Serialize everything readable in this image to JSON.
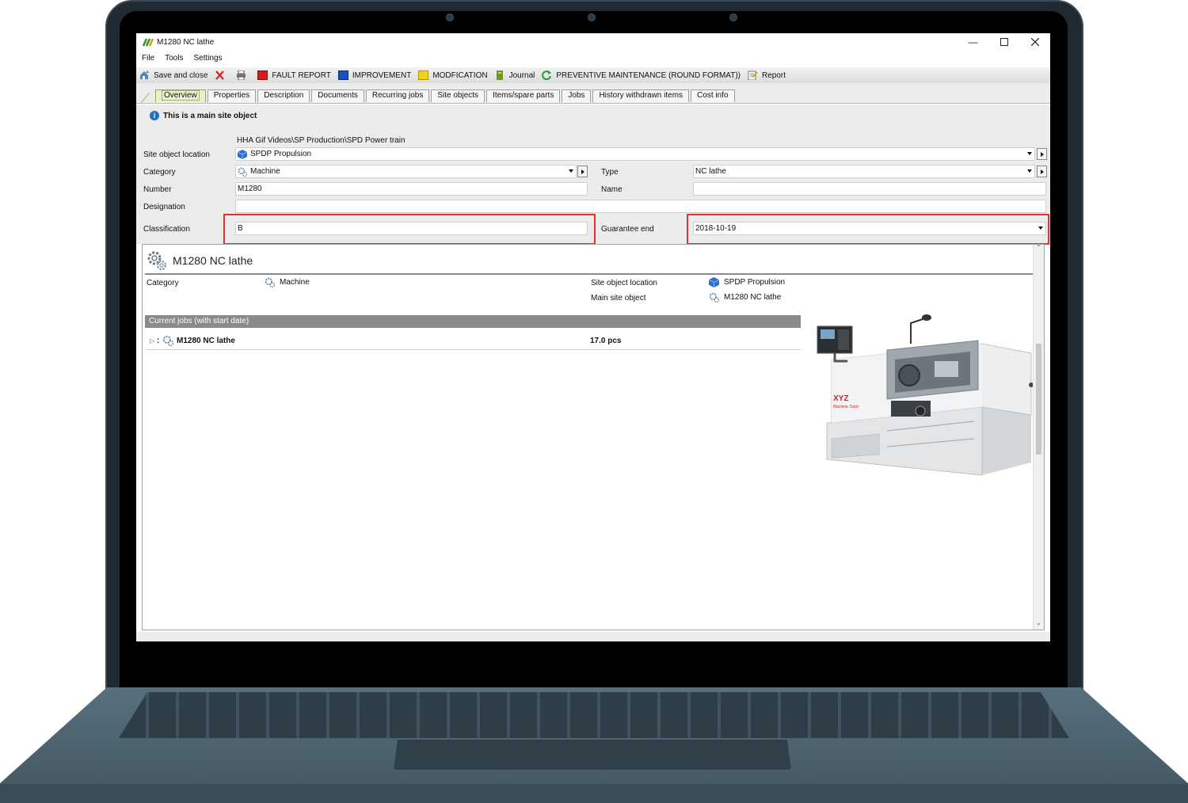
{
  "window": {
    "title": "M1280  NC lathe"
  },
  "menu": [
    "File",
    "Tools",
    "Settings"
  ],
  "toolbar": {
    "save_close": "Save and close",
    "fault_report": "FAULT REPORT",
    "improvement": "IMPROVEMENT",
    "modification": "MODFICATION",
    "journal": "Journal",
    "preventive": "PREVENTIVE MAINTENANCE (ROUND FORMAT))",
    "report": "Report"
  },
  "tabs": [
    "Overview",
    "Properties",
    "Description",
    "Documents",
    "Recurring jobs",
    "Site objects",
    "Items/spare parts",
    "Jobs",
    "History withdrawn items",
    "Cost info"
  ],
  "info": {
    "text": "This is a main site object"
  },
  "form": {
    "path": "HHA Gif Videos\\SP Production\\SPD Power train",
    "site_location_label": "Site object location",
    "site_location_value": "SPDP Propulsion",
    "category_label": "Category",
    "category_value": "Machine",
    "type_label": "Type",
    "type_value": "NC lathe",
    "number_label": "Number",
    "number_value": "M1280",
    "name_label": "Name",
    "name_value": "",
    "designation_label": "Designation",
    "designation_value": "",
    "classification_label": "Classification",
    "classification_value": "B",
    "guarantee_label": "Guarantee end",
    "guarantee_value": "2018-10-19"
  },
  "overview": {
    "title": "M1280  NC lathe",
    "category_label": "Category",
    "category_value": "Machine",
    "site_location_label": "Site object location",
    "site_location_value": "SPDP Propulsion",
    "main_object_label": "Main site object",
    "main_object_value": "M1280  NC lathe",
    "jobs_header": "Current jobs (with start date)",
    "jobs": [
      {
        "colon": ":",
        "name": "M1280  NC lathe",
        "qty": "17.0 pcs"
      }
    ],
    "photo_brand": "XYZ",
    "photo_sub": "Machine Tools"
  },
  "colors": {
    "highlight": "#e03232",
    "accent": "#8fb23b",
    "info": "#1d6fc8"
  }
}
